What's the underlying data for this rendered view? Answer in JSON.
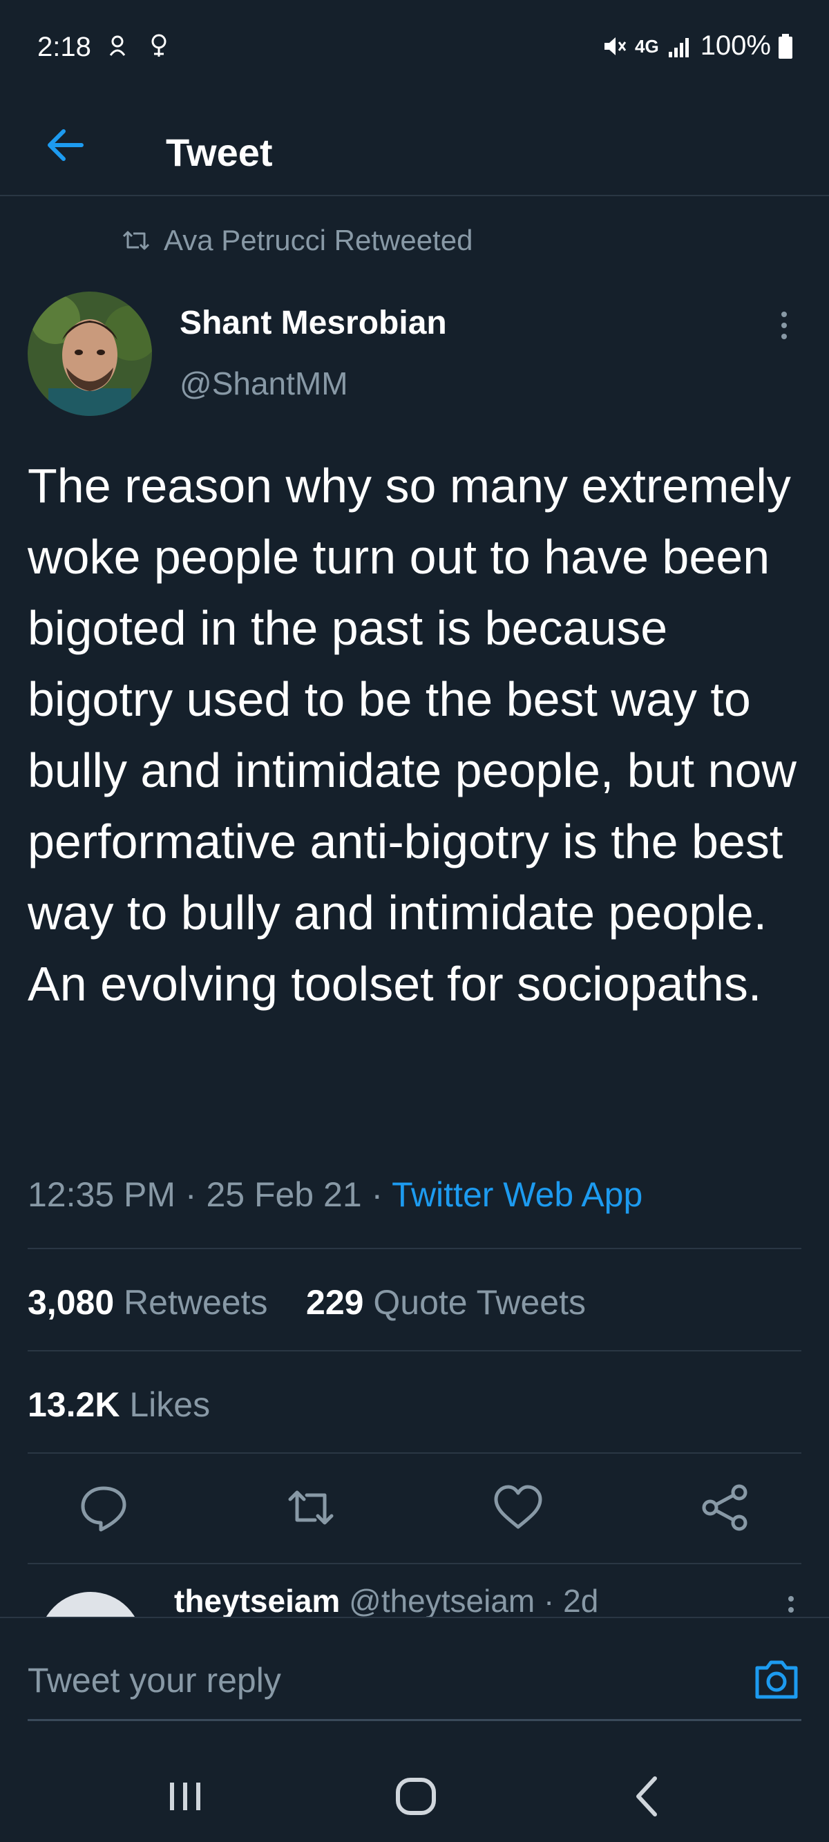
{
  "status_bar": {
    "time": "2:18",
    "battery": "100%",
    "network": "4G"
  },
  "header": {
    "title": "Tweet"
  },
  "retweet_context": {
    "text": "Ava Petrucci Retweeted"
  },
  "author": {
    "name": "Shant Mesrobian",
    "handle": "@ShantMM"
  },
  "tweet": {
    "text": "The reason why so many extremely woke people turn out to have been bigoted in the past is because bigotry used to be the best way to bully and intimidate people, but now performative anti-bigotry is the best way to bully and intimidate people. An evolving toolset for sociopaths.",
    "time": "12:35 PM",
    "date": "25 Feb 21",
    "separator": " · ",
    "source": "Twitter Web App"
  },
  "stats": {
    "retweets_count": "3,080",
    "retweets_label": "Retweets",
    "quotes_count": "229",
    "quotes_label": "Quote Tweets",
    "likes_count": "13.2K",
    "likes_label": "Likes"
  },
  "reply_preview": {
    "name": "theytseiam",
    "handle": "@theytseiam · 2d"
  },
  "composer": {
    "placeholder": "Tweet your reply"
  },
  "colors": {
    "background": "#15202b",
    "accent": "#1d9bf0",
    "secondary_text": "#8899a6",
    "divider": "#2a3744"
  }
}
